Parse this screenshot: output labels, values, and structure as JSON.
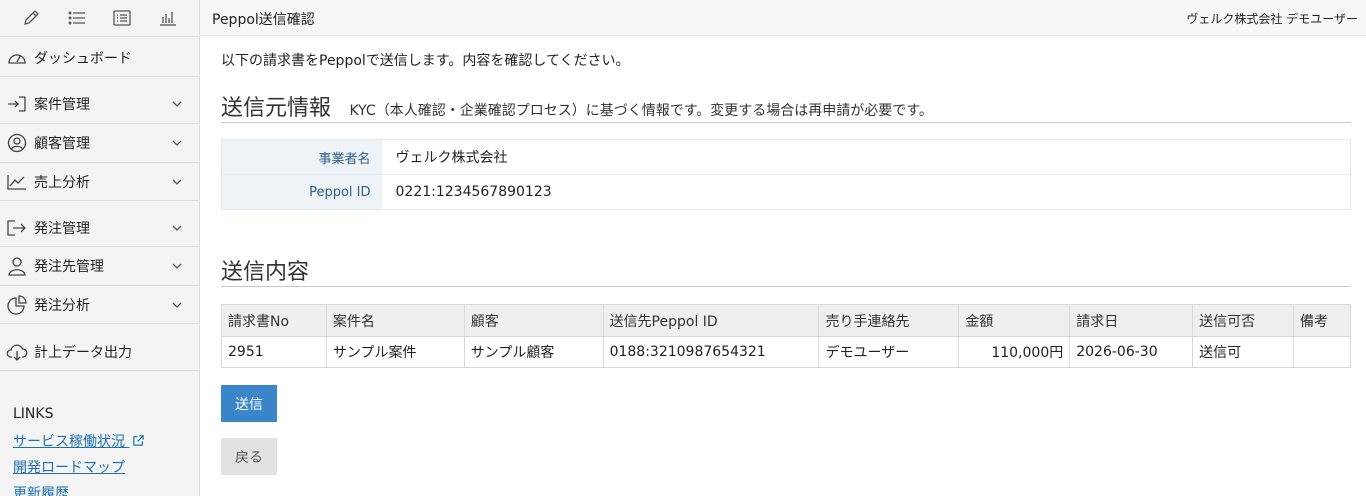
{
  "header": {
    "title": "Peppol送信確認",
    "user": "ヴェルク株式会社 デモユーザー"
  },
  "toolbar": {
    "icons": [
      "pencil-icon",
      "list-icon",
      "list-box-icon",
      "chart-icon"
    ]
  },
  "sidebar": {
    "items": [
      {
        "label": "ダッシュボード",
        "icon": "gauge-icon"
      },
      {
        "label": "案件管理",
        "icon": "login-icon"
      },
      {
        "label": "顧客管理",
        "icon": "user-circle-icon"
      },
      {
        "label": "売上分析",
        "icon": "trend-icon"
      },
      {
        "label": "発注管理",
        "icon": "share-icon"
      },
      {
        "label": "発注先管理",
        "icon": "user-icon"
      },
      {
        "label": "発注分析",
        "icon": "pie-icon"
      },
      {
        "label": "計上データ出力",
        "icon": "cloud-download-icon"
      }
    ],
    "links_title": "LINKS",
    "links": [
      "サービス稼働状況",
      "開発ロードマップ",
      "更新履歴"
    ]
  },
  "main": {
    "intro": "以下の請求書をPeppolで送信します。内容を確認してください。",
    "sender": {
      "heading": "送信元情報",
      "description": "KYC（本人確認・企業確認プロセス）に基づく情報です。変更する場合は再申請が必要です。",
      "rows": [
        {
          "label": "事業者名",
          "value": "ヴェルク株式会社"
        },
        {
          "label": "Peppol ID",
          "value": "0221:1234567890123"
        }
      ]
    },
    "content": {
      "heading": "送信内容",
      "columns": [
        "請求書No",
        "案件名",
        "顧客",
        "送信先Peppol ID",
        "売り手連絡先",
        "金額",
        "請求日",
        "送信可否",
        "備考"
      ],
      "rows": [
        [
          "2951",
          "サンプル案件",
          "サンプル顧客",
          "0188:3210987654321",
          "デモユーザー",
          "110,000円",
          "2026-06-30",
          "送信可",
          ""
        ]
      ]
    },
    "buttons": {
      "send": "送信",
      "back": "戻る"
    }
  },
  "colors": {
    "primary": "#3a86c8",
    "link": "#1f6fb5",
    "label": "#2f5f8a"
  }
}
